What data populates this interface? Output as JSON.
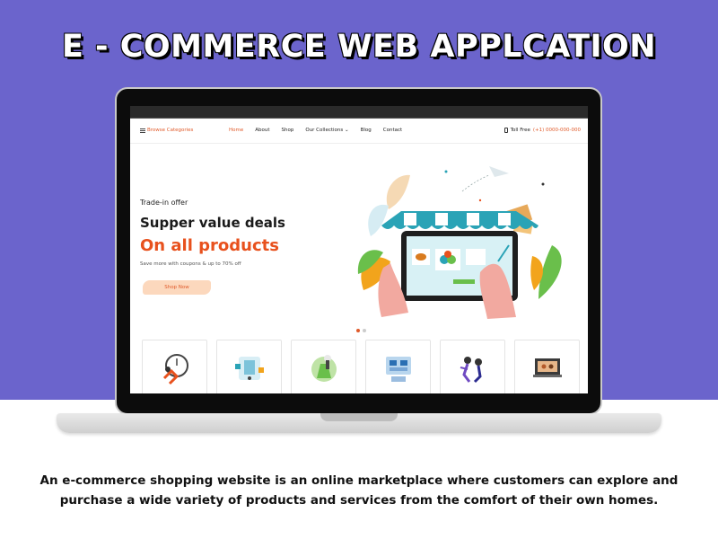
{
  "banner": {
    "title": "E - COMMERCE WEB APPLCATION",
    "background_color": "#6b64cc"
  },
  "site": {
    "nav": {
      "browse_label": "Browse Categories",
      "links": [
        "Home",
        "About",
        "Shop",
        "Our Collections",
        "Blog",
        "Contact"
      ],
      "active_link": "Home",
      "phone_label": "Toll Free",
      "phone_number": "(+1) 0000-000-000"
    },
    "hero": {
      "offer_label": "Trade-in offer",
      "headline_line1": "Supper value deals",
      "headline_line2": "On all products",
      "subtext": "Save more with coupons & up to 70% off",
      "cta_label": "Shop Now",
      "accent_color": "#e8511d"
    },
    "feature_cards": [
      {
        "icon": "running-person-icon"
      },
      {
        "icon": "phone-shopping-icon"
      },
      {
        "icon": "gift-bag-icon"
      },
      {
        "icon": "chat-shopping-icon"
      },
      {
        "icon": "people-dancing-icon"
      },
      {
        "icon": "laptop-store-icon"
      }
    ]
  },
  "caption": "An e-commerce shopping website is an online marketplace where customers can explore and purchase a wide variety of products and services from the comfort of their own homes."
}
